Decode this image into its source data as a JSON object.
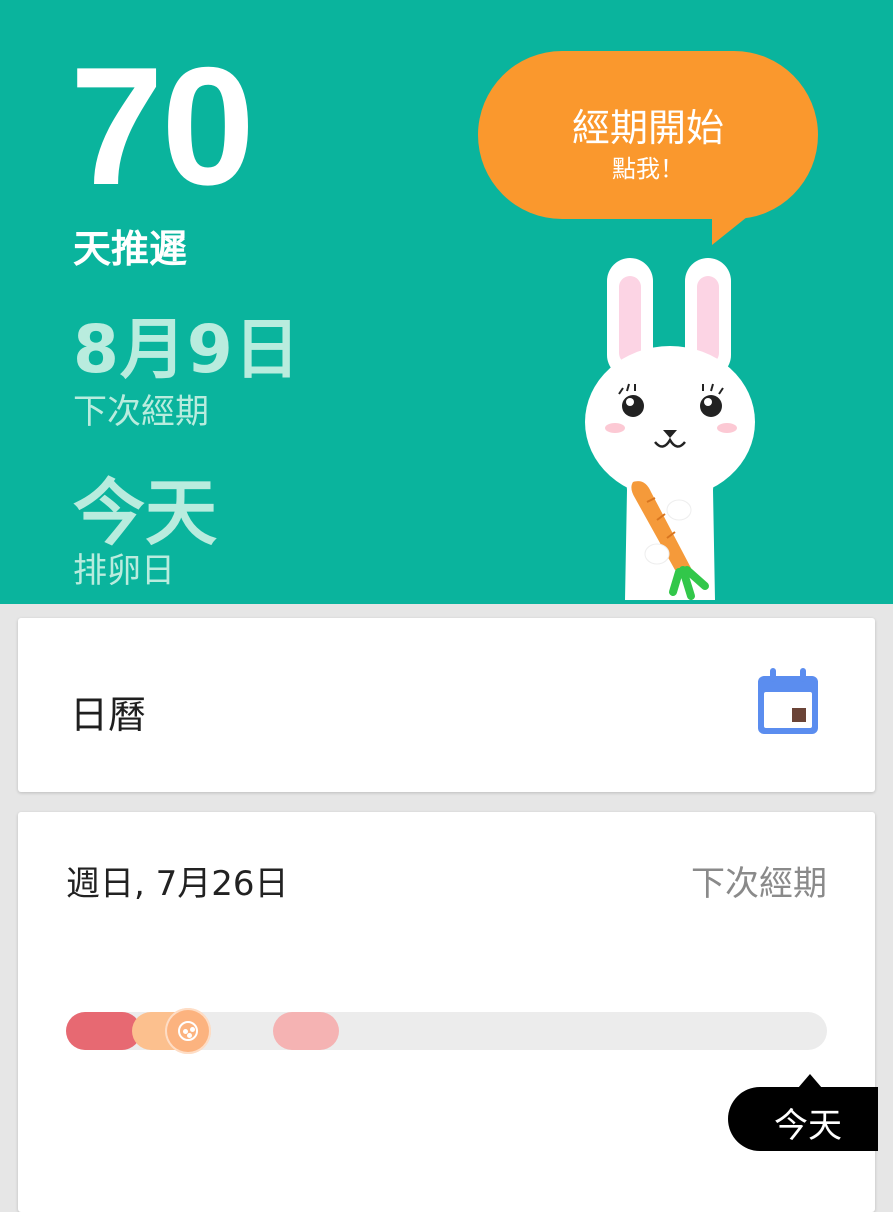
{
  "summary": {
    "days_late_value": "70",
    "days_late_label": "天推遲",
    "next_period_date": "8月9日",
    "next_period_label": "下次經期",
    "ovulation_value": "今天",
    "ovulation_label": "排卵日"
  },
  "bubble": {
    "title": "經期開始",
    "subtitle": "點我！"
  },
  "calendar_card": {
    "label": "日曆",
    "icon": "calendar-icon"
  },
  "cycle_card": {
    "date": "週日, 7月26日",
    "next_label": "下次經期",
    "today_label": "今天"
  },
  "colors": {
    "teal": "#0ab49d",
    "orange": "#fa982d",
    "period": "#e76972",
    "fertile": "#fcc08e",
    "pms": "#f5b3b3",
    "calendar_blue": "#5b8def"
  }
}
